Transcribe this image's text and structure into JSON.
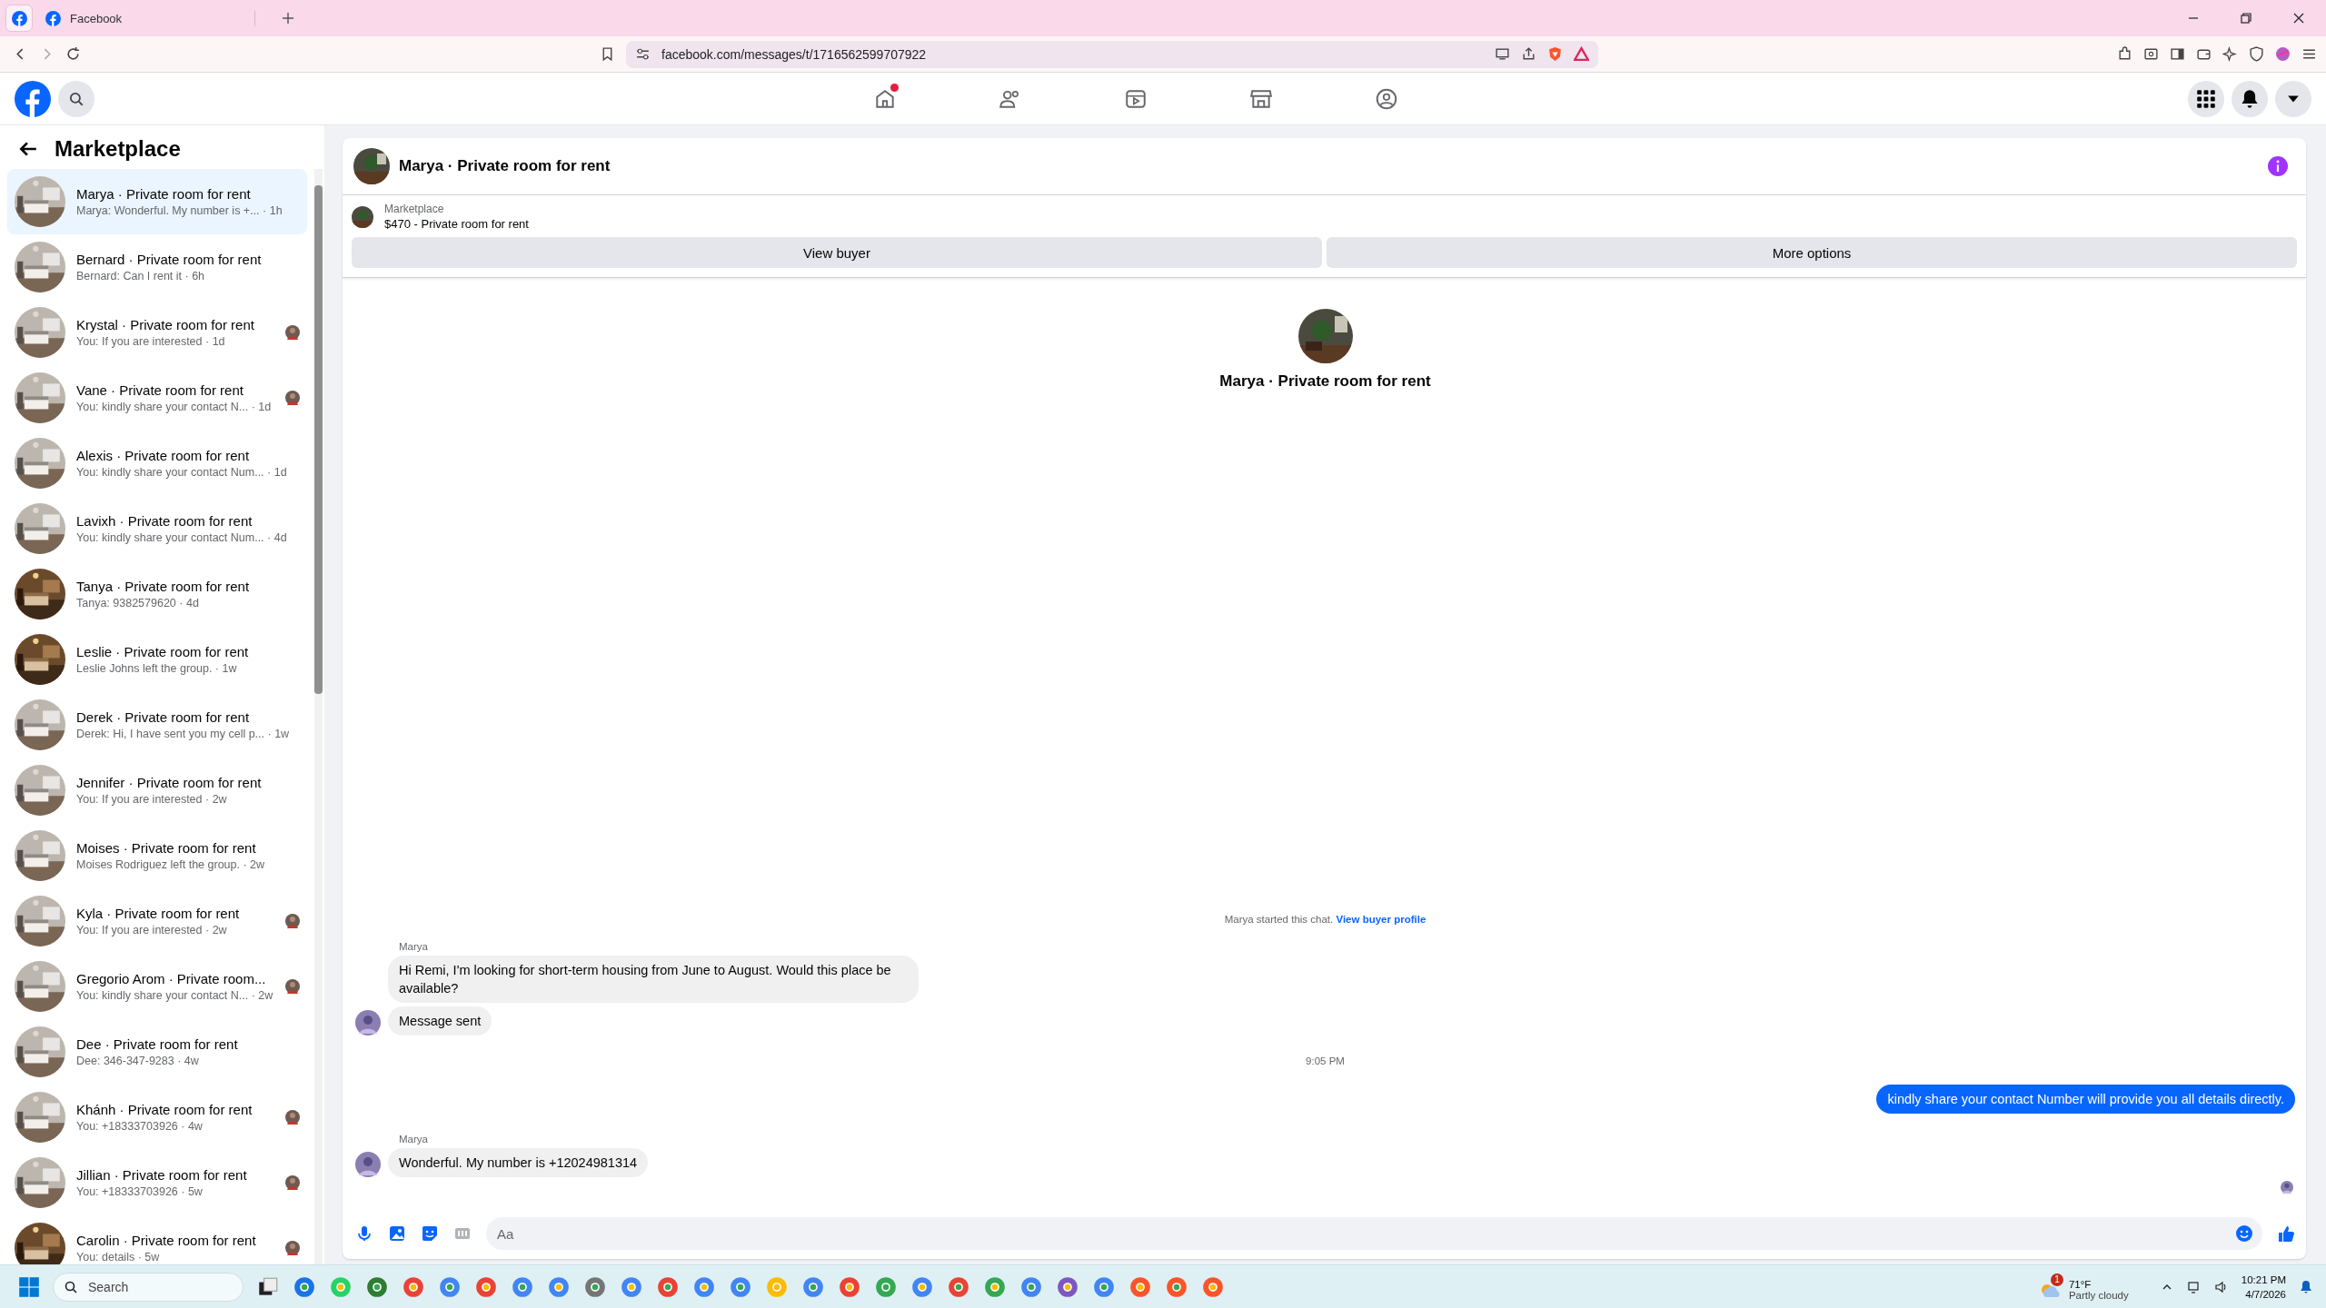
{
  "browser": {
    "tab_title": "Facebook",
    "url": "facebook.com/messages/t/1716562599707922"
  },
  "nav": {
    "tabs": [
      {
        "kind": "home",
        "badge": true
      },
      {
        "kind": "friends",
        "badge": false
      },
      {
        "kind": "video",
        "badge": false
      },
      {
        "kind": "marketplace",
        "badge": false
      },
      {
        "kind": "groups",
        "badge": false
      }
    ]
  },
  "sidebar": {
    "title": "Marketplace",
    "conversations": [
      {
        "title": "Marya · Private room for rent",
        "preview": "Marya: Wonderful. My number is +... · 1h",
        "selected": true,
        "seen_avatar": false
      },
      {
        "title": "Bernard · Private room for rent",
        "preview": "Bernard: Can I rent it · 6h",
        "selected": false,
        "seen_avatar": false
      },
      {
        "title": "Krystal · Private room for rent",
        "preview": "You: If you are interested · 1d",
        "selected": false,
        "seen_avatar": true
      },
      {
        "title": "Vane · Private room for rent",
        "preview": "You: kindly share your contact N... · 1d",
        "selected": false,
        "seen_avatar": true
      },
      {
        "title": "Alexis · Private room for rent",
        "preview": "You: kindly share your contact Num... · 1d",
        "selected": false,
        "seen_avatar": false
      },
      {
        "title": "Lavixh · Private room for rent",
        "preview": "You: kindly share your contact Num... · 4d",
        "selected": false,
        "seen_avatar": false
      },
      {
        "title": "Tanya · Private room for rent",
        "preview": "Tanya: 9382579620 · 4d",
        "selected": false,
        "seen_avatar": false
      },
      {
        "title": "Leslie · Private room for rent",
        "preview": "Leslie Johns left the group. · 1w",
        "selected": false,
        "seen_avatar": false
      },
      {
        "title": "Derek · Private room for rent",
        "preview": "Derek: Hi, I have sent you my cell p... · 1w",
        "selected": false,
        "seen_avatar": false
      },
      {
        "title": "Jennifer · Private room for rent",
        "preview": "You: If you are interested · 2w",
        "selected": false,
        "seen_avatar": false
      },
      {
        "title": "Moises · Private room for rent",
        "preview": "Moises Rodriguez left the group. · 2w",
        "selected": false,
        "seen_avatar": false
      },
      {
        "title": "Kyla · Private room for rent",
        "preview": "You: If you are interested · 2w",
        "selected": false,
        "seen_avatar": true
      },
      {
        "title": "Gregorio Arom · Private room...",
        "preview": "You: kindly share your contact N... · 2w",
        "selected": false,
        "seen_avatar": true
      },
      {
        "title": "Dee · Private room for rent",
        "preview": "Dee: 346-347-9283 · 4w",
        "selected": false,
        "seen_avatar": false
      },
      {
        "title": "Khánh · Private room for rent",
        "preview": "You: +18333703926 · 4w",
        "selected": false,
        "seen_avatar": true
      },
      {
        "title": "Jillian · Private room for rent",
        "preview": "You: +18333703926 · 5w",
        "selected": false,
        "seen_avatar": true
      },
      {
        "title": "Carolin · Private room for rent",
        "preview": "You: details · 5w",
        "selected": false,
        "seen_avatar": true
      }
    ]
  },
  "chat": {
    "title": "Marya · Private room for rent",
    "listing": {
      "label": "Marketplace",
      "item": "$470 - Private room for rent"
    },
    "buttons": [
      "View buyer",
      "More options"
    ],
    "intro_title": "Marya · Private room for rent",
    "system_note": {
      "text": "Marya started this chat.",
      "link": "View buyer profile"
    },
    "messages": [
      {
        "kind": "sender",
        "text": "Marya"
      },
      {
        "kind": "incoming",
        "text": "Hi Remi, I'm looking for short-term housing from June to August. Would this place be available?",
        "avatar": false
      },
      {
        "kind": "incoming",
        "text": "Message sent",
        "avatar": true
      },
      {
        "kind": "time",
        "text": "9:05 PM"
      },
      {
        "kind": "outgoing",
        "text": "kindly share your contact Number will provide you all details directly."
      },
      {
        "kind": "sender",
        "text": "Marya"
      },
      {
        "kind": "incoming",
        "text": "Wonderful. My number is +12024981314",
        "avatar": true
      },
      {
        "kind": "seen"
      }
    ],
    "composer": {
      "placeholder": "Aa"
    }
  },
  "taskbar": {
    "search_placeholder": "Search",
    "weather": {
      "badge": "1",
      "temp": "71°F",
      "desc": "Partly cloudy"
    },
    "time": "10:21 PM",
    "date": "4/7/2026"
  }
}
